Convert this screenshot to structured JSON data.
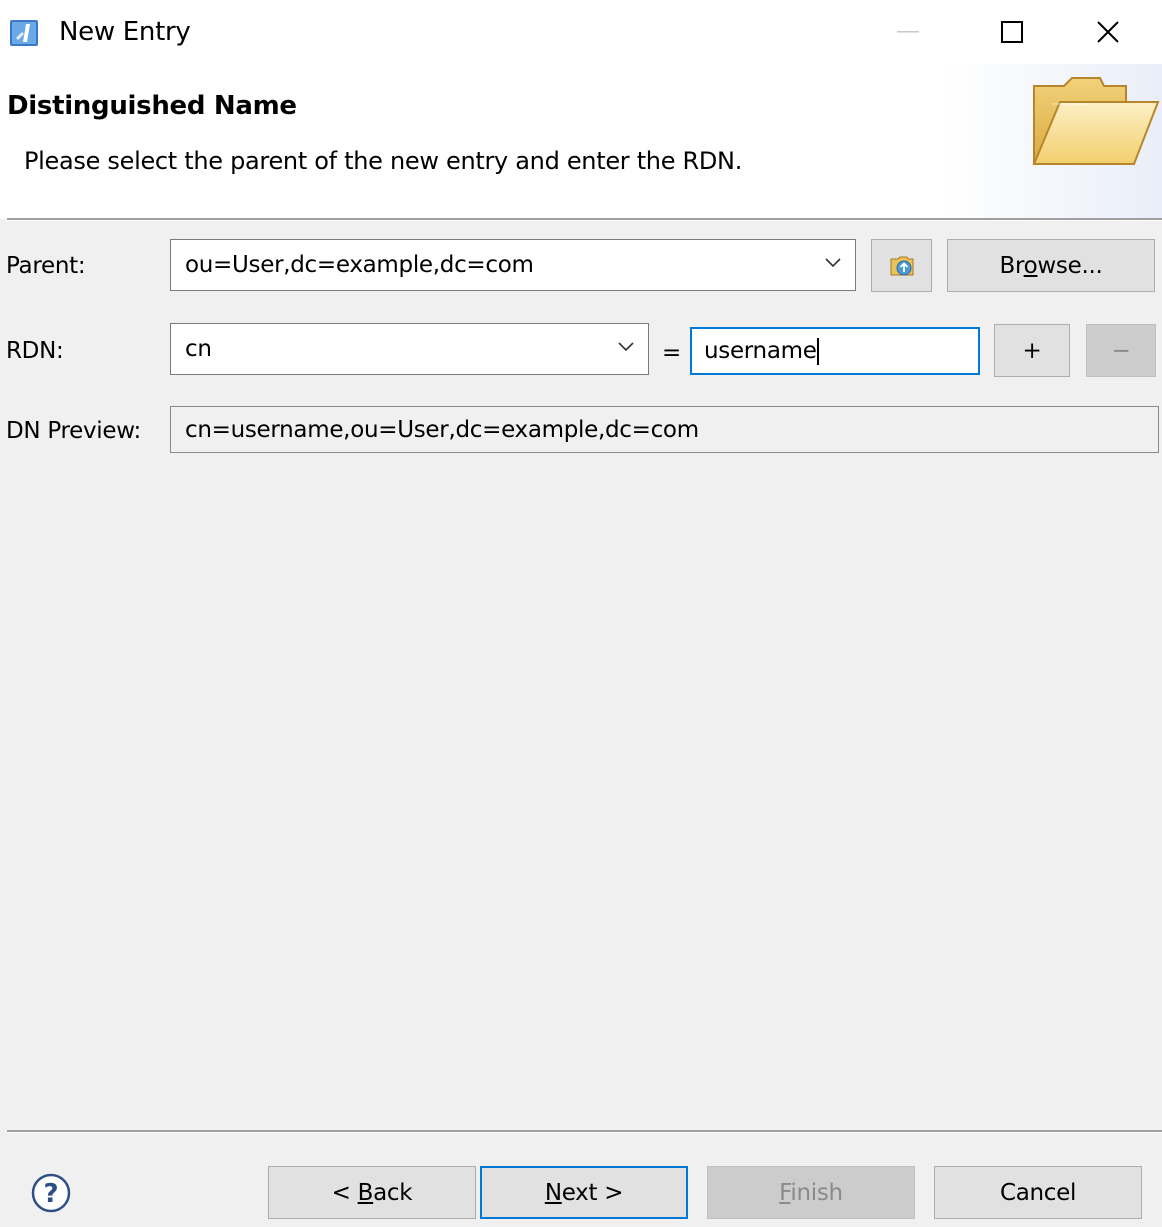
{
  "window": {
    "title": "New Entry",
    "controls": [
      "minimize",
      "maximize",
      "close"
    ]
  },
  "header": {
    "title": "Distinguished Name",
    "description": "Please select the parent of the new entry and enter the RDN.",
    "icon": "folder-open-icon"
  },
  "form": {
    "parent": {
      "label": "Parent:",
      "value": "ou=User,dc=example,dc=com",
      "browse_prefix": "Br",
      "browse_mnemonic": "o",
      "browse_suffix": "wse..."
    },
    "rdn": {
      "label": "RDN:",
      "type_value": "cn",
      "equals": "=",
      "value": "username",
      "add_label": "+",
      "remove_label": "−"
    },
    "dn_preview": {
      "label": "DN Preview:",
      "value": "cn=username,ou=User,dc=example,dc=com"
    }
  },
  "footer": {
    "help_icon": "help-icon",
    "back": {
      "prefix": "< ",
      "mnemonic": "B",
      "suffix": "ack"
    },
    "next": {
      "mnemonic": "N",
      "suffix": "ext >"
    },
    "finish": {
      "mnemonic": "F",
      "suffix": "inish"
    },
    "cancel": "Cancel"
  },
  "colors": {
    "focus_border": "#0078d7",
    "dialog_bg": "#f0f0f0",
    "button_bg": "#e1e1e1"
  }
}
